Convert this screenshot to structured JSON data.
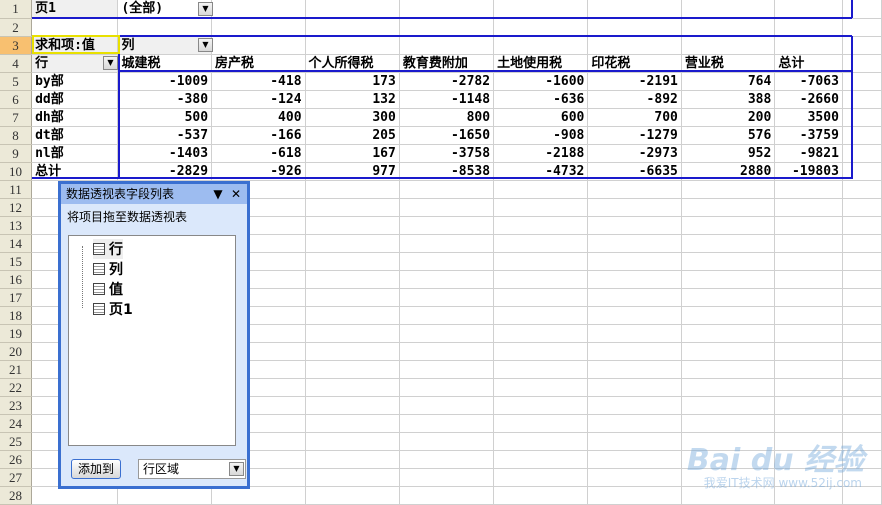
{
  "page_field": {
    "label": "页1",
    "value": "(全部)"
  },
  "data_label": "求和项:值",
  "column_field": "列",
  "row_field": "行",
  "columns": [
    "城建税",
    "房产税",
    "个人所得税",
    "教育费附加",
    "土地使用税",
    "印花税",
    "营业税",
    "总计"
  ],
  "rows": [
    {
      "name": "by部",
      "values": [
        "-1009",
        "-418",
        "173",
        "-2782",
        "-1600",
        "-2191",
        "764",
        "-7063"
      ]
    },
    {
      "name": "dd部",
      "values": [
        "-380",
        "-124",
        "132",
        "-1148",
        "-636",
        "-892",
        "388",
        "-2660"
      ]
    },
    {
      "name": "dh部",
      "values": [
        "500",
        "400",
        "300",
        "800",
        "600",
        "700",
        "200",
        "3500"
      ]
    },
    {
      "name": "dt部",
      "values": [
        "-537",
        "-166",
        "205",
        "-1650",
        "-908",
        "-1279",
        "576",
        "-3759"
      ]
    },
    {
      "name": "nl部",
      "values": [
        "-1403",
        "-618",
        "167",
        "-3758",
        "-2188",
        "-2973",
        "952",
        "-9821"
      ]
    },
    {
      "name": "总计",
      "values": [
        "-2829",
        "-926",
        "977",
        "-8538",
        "-4732",
        "-6635",
        "2880",
        "-19803"
      ]
    }
  ],
  "row_numbers": [
    "1",
    "2",
    "3",
    "4",
    "5",
    "6",
    "7",
    "8",
    "9",
    "10",
    "11",
    "12",
    "13",
    "14",
    "15",
    "16",
    "17",
    "18",
    "19",
    "20",
    "21",
    "22",
    "23",
    "24",
    "25",
    "26",
    "27",
    "28"
  ],
  "panel": {
    "title": "数据透视表字段列表",
    "hint": "将项目拖至数据透视表",
    "fields": [
      "行",
      "列",
      "值",
      "页1"
    ],
    "add_button": "添加到",
    "area_select": "行区域"
  },
  "watermark": {
    "logo": "Baidu经验",
    "sub": "我爱IT技术网 www.52ij.com"
  }
}
